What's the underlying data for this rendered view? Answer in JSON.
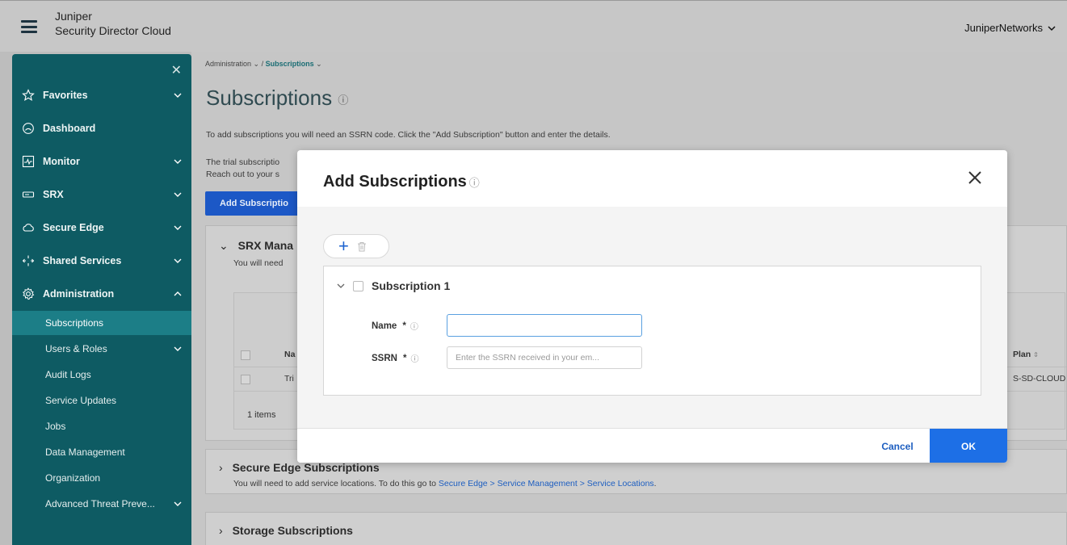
{
  "header": {
    "brand_line1": "Juniper",
    "brand_line2": "Security Director Cloud",
    "user": "JuniperNetworks"
  },
  "sidebar": {
    "close_glyph": "✕",
    "nav": [
      {
        "label": "Favorites",
        "icon": "star-icon"
      },
      {
        "label": "Dashboard",
        "icon": "gauge-icon"
      },
      {
        "label": "Monitor",
        "icon": "monitor-icon"
      },
      {
        "label": "SRX",
        "icon": "device-icon"
      },
      {
        "label": "Secure Edge",
        "icon": "cloud-icon"
      },
      {
        "label": "Shared Services",
        "icon": "arrows-icon"
      },
      {
        "label": "Administration",
        "icon": "gear-icon"
      }
    ],
    "sub": [
      {
        "label": "Subscriptions",
        "active": true
      },
      {
        "label": "Users & Roles"
      },
      {
        "label": "Audit Logs"
      },
      {
        "label": "Service Updates"
      },
      {
        "label": "Jobs"
      },
      {
        "label": "Data Management"
      },
      {
        "label": "Organization"
      },
      {
        "label": "Advanced Threat Preve..."
      }
    ]
  },
  "main": {
    "breadcrumb_parent": "Administration",
    "breadcrumb_sep": "/",
    "breadcrumb_current": "Subscriptions",
    "title": "Subscriptions",
    "intro": "To add subscriptions you will need an SSRN code. Click the \"Add Subscription\" button and enter the details.",
    "trial_line1": "The trial subscriptio",
    "trial_line2": "Reach out to your s",
    "add_button": "Add Subscriptio",
    "srx_panel": {
      "title": "SRX Mana",
      "subtitle": "You will need",
      "header_col": "Na",
      "plan_header": "Plan",
      "sort_glyph": "⇕",
      "row_col": "Tri",
      "plan_value": "S-SD-CLOUD",
      "items": "1 items"
    },
    "edge_panel": {
      "title": "Secure Edge Subscriptions",
      "subtitle": "You will need to add service locations. To do this go to",
      "link": "Secure Edge > Service Management > Service Locations",
      "period": "."
    },
    "storage_panel": {
      "title": "Storage Subscriptions"
    }
  },
  "modal": {
    "title": "Add Subscriptions",
    "help_glyph": "?",
    "add_glyph": "+",
    "card_title": "Subscription 1",
    "name_label": "Name",
    "ssrn_label": "SSRN",
    "required_mark": "*",
    "name_value": "",
    "ssrn_placeholder": "Enter the SSRN received in your em...",
    "cancel": "Cancel",
    "ok": "OK"
  }
}
